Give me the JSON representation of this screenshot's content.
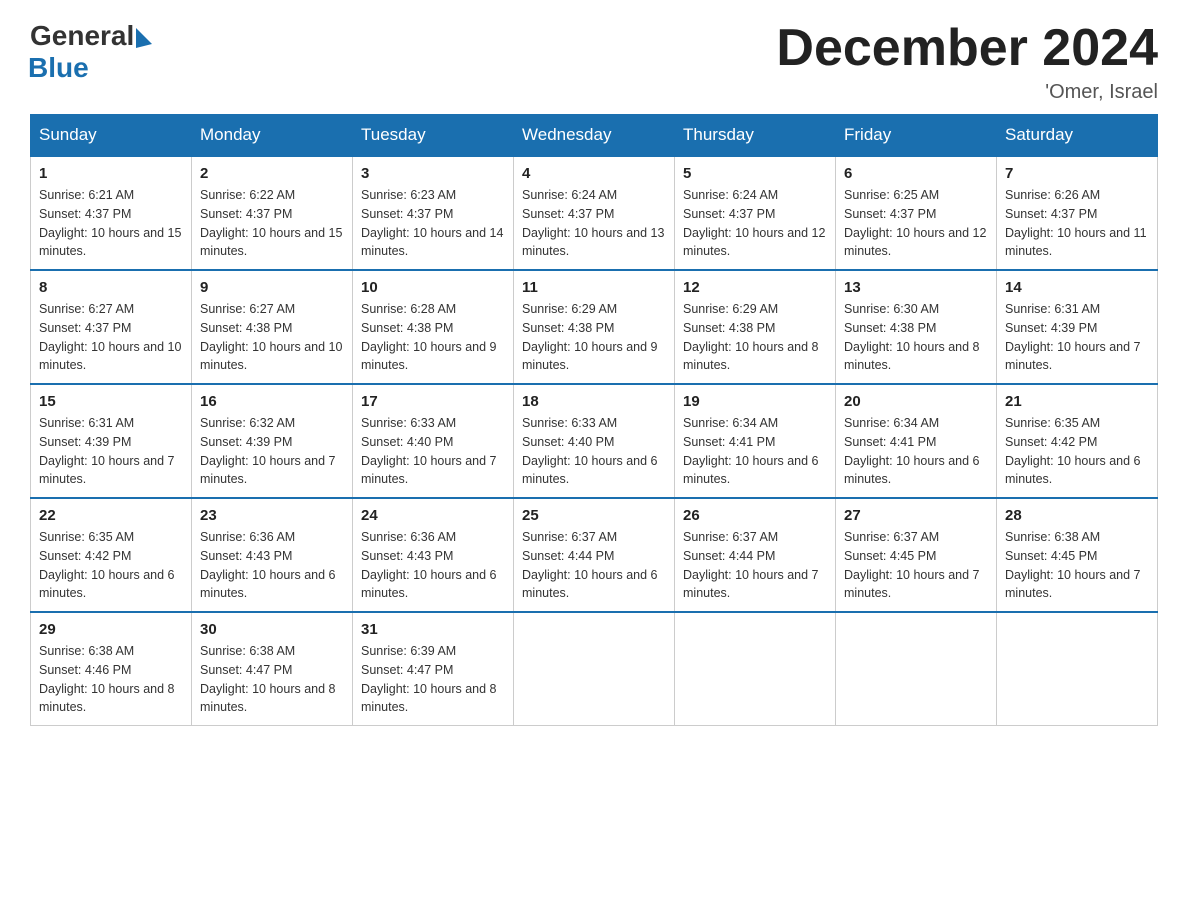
{
  "logo": {
    "general": "General",
    "blue": "Blue"
  },
  "title": "December 2024",
  "subtitle": "'Omer, Israel",
  "days_of_week": [
    "Sunday",
    "Monday",
    "Tuesday",
    "Wednesday",
    "Thursday",
    "Friday",
    "Saturday"
  ],
  "weeks": [
    [
      {
        "day": "1",
        "sunrise": "6:21 AM",
        "sunset": "4:37 PM",
        "daylight": "10 hours and 15 minutes."
      },
      {
        "day": "2",
        "sunrise": "6:22 AM",
        "sunset": "4:37 PM",
        "daylight": "10 hours and 15 minutes."
      },
      {
        "day": "3",
        "sunrise": "6:23 AM",
        "sunset": "4:37 PM",
        "daylight": "10 hours and 14 minutes."
      },
      {
        "day": "4",
        "sunrise": "6:24 AM",
        "sunset": "4:37 PM",
        "daylight": "10 hours and 13 minutes."
      },
      {
        "day": "5",
        "sunrise": "6:24 AM",
        "sunset": "4:37 PM",
        "daylight": "10 hours and 12 minutes."
      },
      {
        "day": "6",
        "sunrise": "6:25 AM",
        "sunset": "4:37 PM",
        "daylight": "10 hours and 12 minutes."
      },
      {
        "day": "7",
        "sunrise": "6:26 AM",
        "sunset": "4:37 PM",
        "daylight": "10 hours and 11 minutes."
      }
    ],
    [
      {
        "day": "8",
        "sunrise": "6:27 AM",
        "sunset": "4:37 PM",
        "daylight": "10 hours and 10 minutes."
      },
      {
        "day": "9",
        "sunrise": "6:27 AM",
        "sunset": "4:38 PM",
        "daylight": "10 hours and 10 minutes."
      },
      {
        "day": "10",
        "sunrise": "6:28 AM",
        "sunset": "4:38 PM",
        "daylight": "10 hours and 9 minutes."
      },
      {
        "day": "11",
        "sunrise": "6:29 AM",
        "sunset": "4:38 PM",
        "daylight": "10 hours and 9 minutes."
      },
      {
        "day": "12",
        "sunrise": "6:29 AM",
        "sunset": "4:38 PM",
        "daylight": "10 hours and 8 minutes."
      },
      {
        "day": "13",
        "sunrise": "6:30 AM",
        "sunset": "4:38 PM",
        "daylight": "10 hours and 8 minutes."
      },
      {
        "day": "14",
        "sunrise": "6:31 AM",
        "sunset": "4:39 PM",
        "daylight": "10 hours and 7 minutes."
      }
    ],
    [
      {
        "day": "15",
        "sunrise": "6:31 AM",
        "sunset": "4:39 PM",
        "daylight": "10 hours and 7 minutes."
      },
      {
        "day": "16",
        "sunrise": "6:32 AM",
        "sunset": "4:39 PM",
        "daylight": "10 hours and 7 minutes."
      },
      {
        "day": "17",
        "sunrise": "6:33 AM",
        "sunset": "4:40 PM",
        "daylight": "10 hours and 7 minutes."
      },
      {
        "day": "18",
        "sunrise": "6:33 AM",
        "sunset": "4:40 PM",
        "daylight": "10 hours and 6 minutes."
      },
      {
        "day": "19",
        "sunrise": "6:34 AM",
        "sunset": "4:41 PM",
        "daylight": "10 hours and 6 minutes."
      },
      {
        "day": "20",
        "sunrise": "6:34 AM",
        "sunset": "4:41 PM",
        "daylight": "10 hours and 6 minutes."
      },
      {
        "day": "21",
        "sunrise": "6:35 AM",
        "sunset": "4:42 PM",
        "daylight": "10 hours and 6 minutes."
      }
    ],
    [
      {
        "day": "22",
        "sunrise": "6:35 AM",
        "sunset": "4:42 PM",
        "daylight": "10 hours and 6 minutes."
      },
      {
        "day": "23",
        "sunrise": "6:36 AM",
        "sunset": "4:43 PM",
        "daylight": "10 hours and 6 minutes."
      },
      {
        "day": "24",
        "sunrise": "6:36 AM",
        "sunset": "4:43 PM",
        "daylight": "10 hours and 6 minutes."
      },
      {
        "day": "25",
        "sunrise": "6:37 AM",
        "sunset": "4:44 PM",
        "daylight": "10 hours and 6 minutes."
      },
      {
        "day": "26",
        "sunrise": "6:37 AM",
        "sunset": "4:44 PM",
        "daylight": "10 hours and 7 minutes."
      },
      {
        "day": "27",
        "sunrise": "6:37 AM",
        "sunset": "4:45 PM",
        "daylight": "10 hours and 7 minutes."
      },
      {
        "day": "28",
        "sunrise": "6:38 AM",
        "sunset": "4:45 PM",
        "daylight": "10 hours and 7 minutes."
      }
    ],
    [
      {
        "day": "29",
        "sunrise": "6:38 AM",
        "sunset": "4:46 PM",
        "daylight": "10 hours and 8 minutes."
      },
      {
        "day": "30",
        "sunrise": "6:38 AM",
        "sunset": "4:47 PM",
        "daylight": "10 hours and 8 minutes."
      },
      {
        "day": "31",
        "sunrise": "6:39 AM",
        "sunset": "4:47 PM",
        "daylight": "10 hours and 8 minutes."
      },
      null,
      null,
      null,
      null
    ]
  ]
}
